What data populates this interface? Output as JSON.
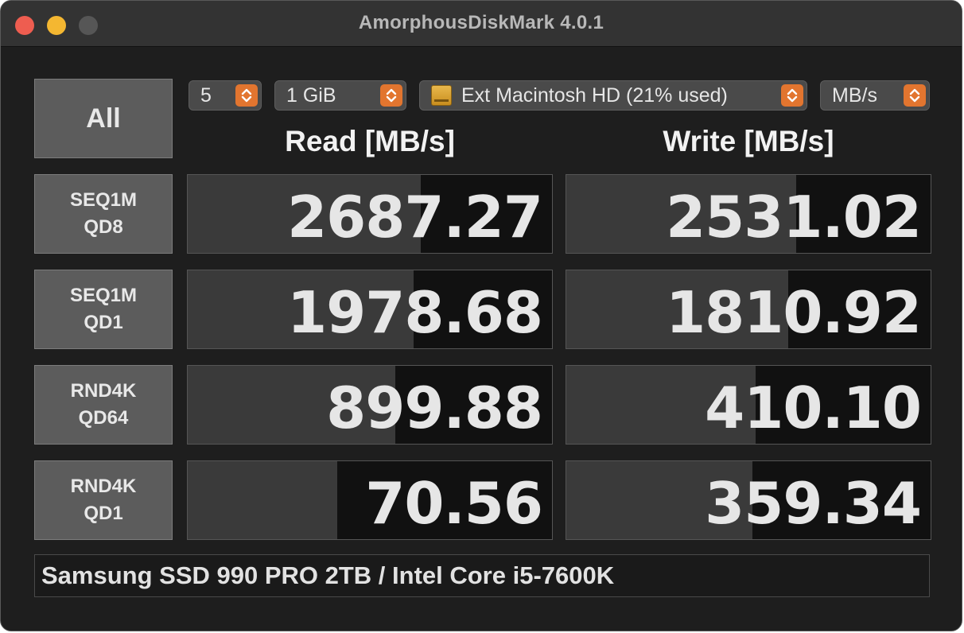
{
  "window": {
    "title": "AmorphousDiskMark 4.0.1"
  },
  "controls": {
    "all_label": "All",
    "runs": "5",
    "size": "1 GiB",
    "disk": "Ext Macintosh HD (21% used)",
    "unit": "MB/s",
    "disk_icon": "external-drive-icon"
  },
  "headers": {
    "read": "Read [MB/s]",
    "write": "Write [MB/s]"
  },
  "tests": [
    {
      "label_line1": "SEQ1M",
      "label_line2": "QD8",
      "read": "2687.27",
      "write": "2531.02",
      "read_fill": 0.64,
      "write_fill": 0.63
    },
    {
      "label_line1": "SEQ1M",
      "label_line2": "QD1",
      "read": "1978.68",
      "write": "1810.92",
      "read_fill": 0.62,
      "write_fill": 0.61
    },
    {
      "label_line1": "RND4K",
      "label_line2": "QD64",
      "read": "899.88",
      "write": "410.10",
      "read_fill": 0.57,
      "write_fill": 0.52
    },
    {
      "label_line1": "RND4K",
      "label_line2": "QD1",
      "read": "70.56",
      "write": "359.34",
      "read_fill": 0.41,
      "write_fill": 0.51
    }
  ],
  "footer": {
    "comment": "Samsung SSD 990 PRO 2TB / Intel Core i5-7600K"
  },
  "colors": {
    "accent": "#e2752f",
    "close": "#ee5d50",
    "minimize": "#f4b731"
  }
}
